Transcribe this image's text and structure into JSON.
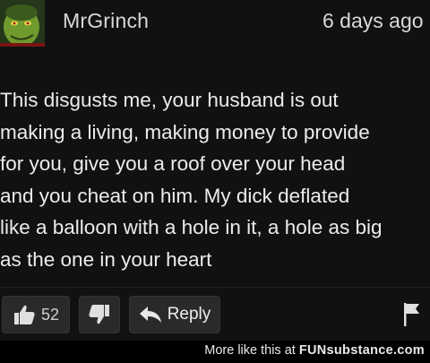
{
  "comment": {
    "username": "MrGrinch",
    "timestamp": "6 days ago",
    "body_lines": [
      "This disgusts me, your husband is out",
      "making a living, making money to provide",
      "for you, give you a roof over your head",
      "and you cheat on him. My dick deflated",
      "like a balloon with a hole in it, a hole as big",
      "as the one in your heart"
    ],
    "like_count": "52",
    "reply_label": "Reply",
    "icons": {
      "avatar": "grinch-avatar",
      "like": "thumbs-up-icon",
      "dislike": "thumbs-down-icon",
      "reply": "reply-arrow-icon",
      "flag": "flag-icon"
    }
  },
  "footer": {
    "text": "More like this at",
    "brand": "FUNsubstance.com"
  },
  "colors": {
    "background": "#111111",
    "button": "#2a2a2a",
    "text": "#ececec"
  }
}
